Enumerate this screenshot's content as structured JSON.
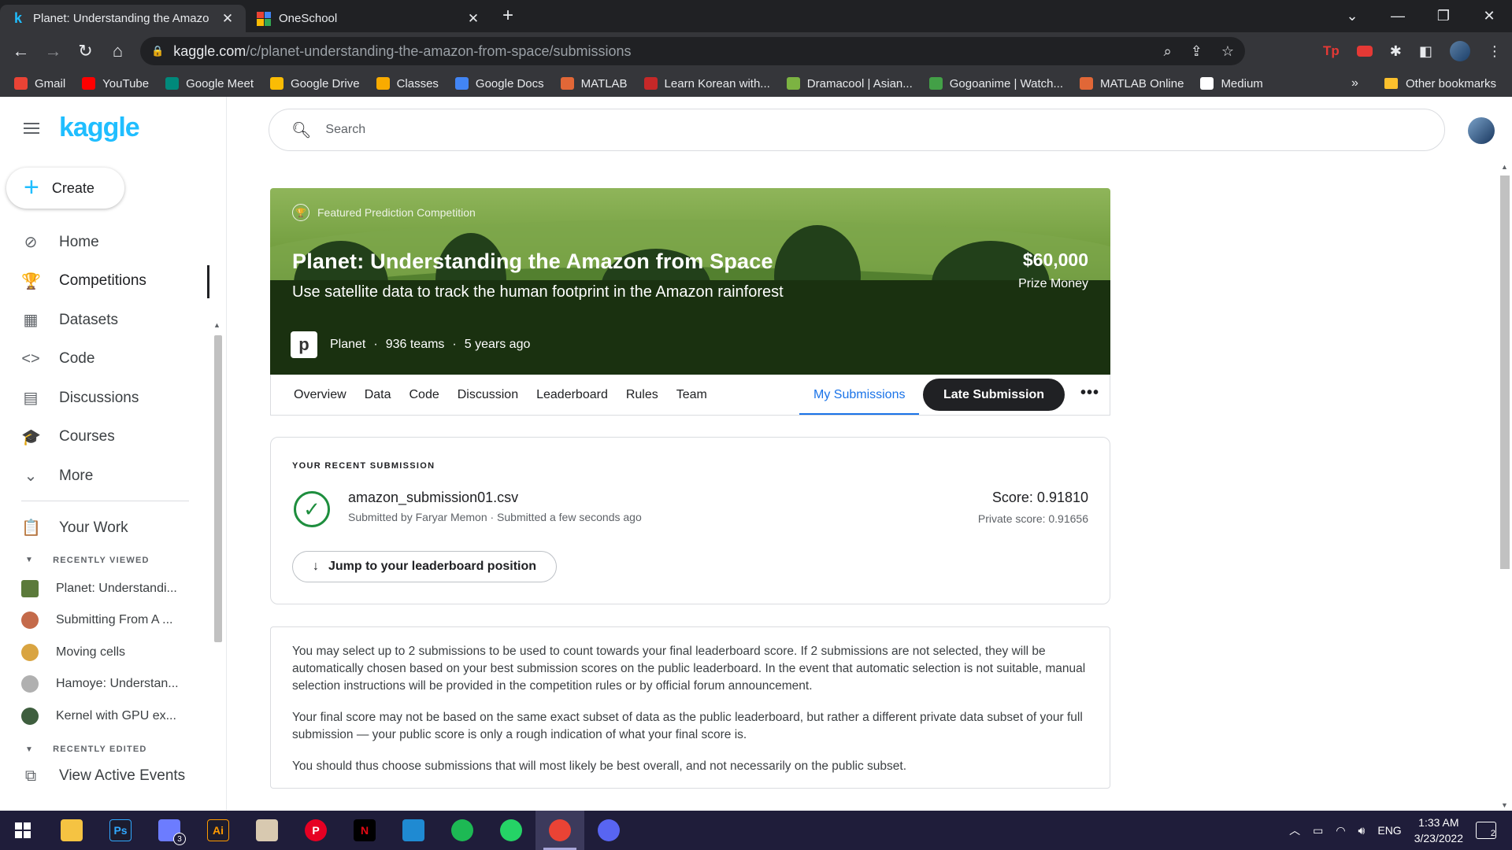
{
  "browser": {
    "tabs": [
      {
        "title": "Planet: Understanding the Amazo",
        "active": true
      },
      {
        "title": "OneSchool",
        "active": false
      }
    ],
    "url_host": "kaggle.com",
    "url_path": "/c/planet-understanding-the-amazon-from-space/submissions",
    "bookmarks": [
      {
        "label": "Gmail",
        "color": "#ea4335"
      },
      {
        "label": "YouTube",
        "color": "#ff0000"
      },
      {
        "label": "Google Meet",
        "color": "#00897b"
      },
      {
        "label": "Google Drive",
        "color": "#fbbc04"
      },
      {
        "label": "Classes",
        "color": "#f9ab00"
      },
      {
        "label": "Google Docs",
        "color": "#4285f4"
      },
      {
        "label": "MATLAB",
        "color": "#e16737"
      },
      {
        "label": "Learn Korean with...",
        "color": "#c62828"
      },
      {
        "label": "Dramacool | Asian...",
        "color": "#7cb342"
      },
      {
        "label": "Gogoanime | Watch...",
        "color": "#43a047"
      },
      {
        "label": "MATLAB Online",
        "color": "#e16737"
      },
      {
        "label": "Medium",
        "color": "#ffffff"
      }
    ],
    "bookmarks_more": "»",
    "other_bookmarks": "Other bookmarks"
  },
  "sidebar": {
    "logo": "kaggle",
    "create_label": "Create",
    "nav": [
      {
        "label": "Home",
        "icon": "compass-icon",
        "glyph": "⊘"
      },
      {
        "label": "Competitions",
        "icon": "trophy-icon",
        "glyph": "🏆",
        "selected": true
      },
      {
        "label": "Datasets",
        "icon": "table-icon",
        "glyph": "▦"
      },
      {
        "label": "Code",
        "icon": "code-icon",
        "glyph": "<>"
      },
      {
        "label": "Discussions",
        "icon": "comment-icon",
        "glyph": "▤"
      },
      {
        "label": "Courses",
        "icon": "school-icon",
        "glyph": "🎓"
      },
      {
        "label": "More",
        "icon": "chevron-down-icon",
        "glyph": "⌄"
      }
    ],
    "your_work": "Your Work",
    "recently_viewed_header": "RECENTLY VIEWED",
    "recently_viewed": [
      {
        "label": "Planet: Understandi...",
        "color": "#5b7a3a"
      },
      {
        "label": "Submitting From A ...",
        "color": "#c46a4a"
      },
      {
        "label": "Moving cells",
        "color": "#d9a441"
      },
      {
        "label": "Hamoye: Understan...",
        "color": "#b0b0b0"
      },
      {
        "label": "Kernel with GPU ex...",
        "color": "#3e5e3e"
      }
    ],
    "recently_edited_header": "RECENTLY EDITED",
    "view_active_events": "View Active Events"
  },
  "search": {
    "placeholder": "Search"
  },
  "competition": {
    "badge": "Featured Prediction Competition",
    "title": "Planet: Understanding the Amazon from Space",
    "subtitle": "Use satellite data to track the human footprint in the Amazon rainforest",
    "host": "Planet",
    "teams": "936 teams",
    "age": "5 years ago",
    "prize_amount": "$60,000",
    "prize_label": "Prize Money",
    "tabs": [
      "Overview",
      "Data",
      "Code",
      "Discussion",
      "Leaderboard",
      "Rules",
      "Team"
    ],
    "my_submissions": "My Submissions",
    "late_submission": "Late Submission"
  },
  "recent_submission": {
    "header": "YOUR RECENT SUBMISSION",
    "filename": "amazon_submission01.csv",
    "submitted_by": "Submitted by Faryar Memon · Submitted a few seconds ago",
    "score": "Score: 0.91810",
    "private_score": "Private score: 0.91656",
    "jump_label": "Jump to your leaderboard position"
  },
  "info": {
    "p1": "You may select up to 2 submissions to be used to count towards your final leaderboard score. If 2 submissions are not selected, they will be automatically chosen based on your best submission scores on the public leaderboard. In the event that automatic selection is not suitable, manual selection instructions will be provided in the competition rules or by official forum announcement.",
    "p2": "Your final score may not be based on the same exact subset of data as the public leaderboard, but rather a different private data subset of your full submission — your public score is only a rough indication of what your final score is.",
    "p3": "You should thus choose submissions that will most likely be best overall, and not necessarily on the public subset."
  },
  "taskbar": {
    "apps": [
      {
        "name": "file-explorer",
        "label": "",
        "color": "#f5c342"
      },
      {
        "name": "photoshop",
        "label": "Ps",
        "color": "#31a8ff"
      },
      {
        "name": "matlab",
        "label": "",
        "color": "#6c7cff"
      },
      {
        "name": "illustrator",
        "label": "Ai",
        "color": "#ff9a00"
      },
      {
        "name": "photo-app",
        "label": "",
        "color": "#d8c9b0"
      },
      {
        "name": "pinterest",
        "label": "P",
        "color": "#e60023"
      },
      {
        "name": "netflix",
        "label": "N",
        "color": "#e50914"
      },
      {
        "name": "vscode",
        "label": "",
        "color": "#1f8ad2"
      },
      {
        "name": "spotify",
        "label": "",
        "color": "#1db954"
      },
      {
        "name": "whatsapp",
        "label": "",
        "color": "#25d366"
      },
      {
        "name": "chrome",
        "label": "",
        "color": "#ea4335"
      },
      {
        "name": "discord",
        "label": "",
        "color": "#5865f2"
      }
    ],
    "matlab_badge": "3",
    "lang": "ENG",
    "time": "1:33 AM",
    "date": "3/23/2022",
    "notifications": "2"
  }
}
